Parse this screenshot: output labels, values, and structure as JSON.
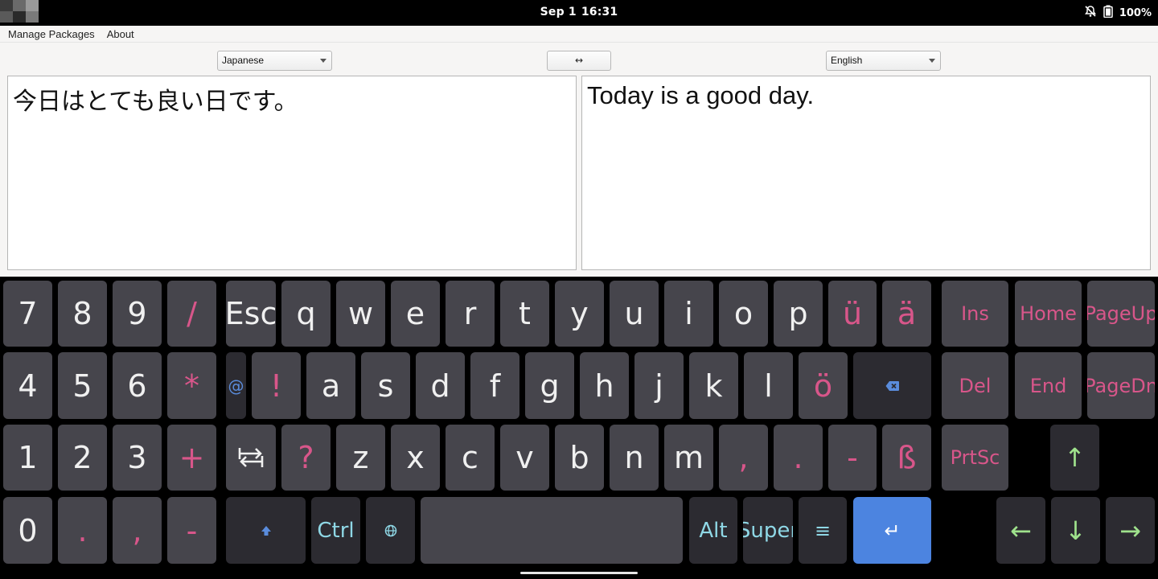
{
  "status": {
    "date": "Sep 1",
    "time": "16:31",
    "battery": "100%"
  },
  "menu": {
    "manage_packages": "Manage Packages",
    "about": "About"
  },
  "source_language": {
    "selected": "Japanese"
  },
  "target_language": {
    "selected": "English"
  },
  "swap_label": "↔",
  "source_text": "今日はとても良い日です。",
  "target_text": "Today is a good day.",
  "keyboard": {
    "numpad": [
      "7",
      "8",
      "9",
      "/",
      "4",
      "5",
      "6",
      "*",
      "1",
      "2",
      "3",
      "+",
      "0",
      ".",
      ",",
      "-"
    ],
    "row1": [
      "Esc",
      "q",
      "w",
      "e",
      "r",
      "t",
      "y",
      "u",
      "i",
      "o",
      "p",
      "ü",
      "ä"
    ],
    "row2": [
      "@",
      "!",
      "a",
      "s",
      "d",
      "f",
      "g",
      "h",
      "j",
      "k",
      "l",
      "ö"
    ],
    "row3": [
      "?",
      "z",
      "x",
      "c",
      "v",
      "b",
      "n",
      "m",
      ",",
      ".",
      "-",
      "ß"
    ],
    "mods": {
      "ctrl": "Ctrl",
      "alt": "Alt",
      "super": "Super",
      "menu": "≡",
      "enter": "↵"
    },
    "nav": {
      "ins": "Ins",
      "home": "Home",
      "pageup": "PageUp",
      "del": "Del",
      "end": "End",
      "pagedn": "PageDn",
      "prtsc": "PrtSc"
    },
    "arrows": {
      "up": "↑",
      "left": "←",
      "down": "↓",
      "right": "→"
    }
  },
  "colors": {
    "key_bg": "#46454c",
    "key_dark_bg": "#2c2b31",
    "accent_pink": "#d8568a",
    "accent_cyan": "#8fd8e6",
    "accent_green": "#9fe28c",
    "enter_blue": "#4c84e0"
  }
}
